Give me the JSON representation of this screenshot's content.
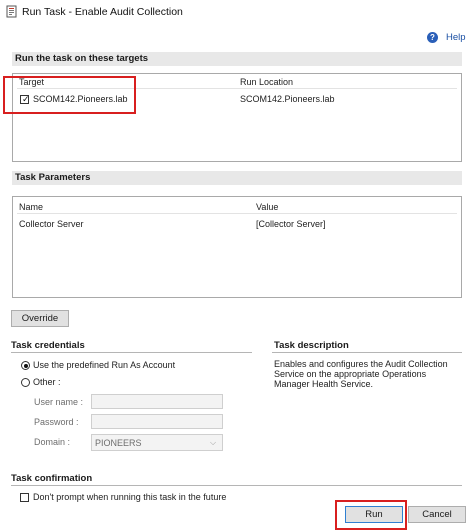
{
  "window": {
    "title": "Run Task - Enable Audit Collection",
    "icon": "task-icon"
  },
  "help": {
    "label": "Help",
    "icon": "help-icon"
  },
  "targets": {
    "header": "Run the task on these targets",
    "columns": [
      "Target",
      "Run Location"
    ],
    "rows": [
      {
        "target": "SCOM142.Pioneers.lab",
        "run_location": "SCOM142.Pioneers.lab",
        "checked": true
      }
    ]
  },
  "parameters": {
    "header": "Task Parameters",
    "columns": [
      "Name",
      "Value"
    ],
    "rows": [
      {
        "name": "Collector Server",
        "value": "[Collector Server]"
      }
    ]
  },
  "override_button": "Override",
  "credentials": {
    "header": "Task credentials",
    "option_default": "Use the predefined Run As Account",
    "option_other": "Other :",
    "selected": "default",
    "username_label": "User name :",
    "password_label": "Password :",
    "domain_label": "Domain :",
    "domain_value": "PIONEERS"
  },
  "description": {
    "header": "Task description",
    "text": "Enables and configures the Audit Collection Service on the appropriate Operations Manager Health Service."
  },
  "confirmation": {
    "header": "Task confirmation",
    "checkbox_label": "Don't prompt when running this task in the future",
    "checked": false
  },
  "buttons": {
    "run": "Run",
    "cancel": "Cancel"
  },
  "colors": {
    "highlight": "#d81f1f",
    "link": "#1a4fa3"
  }
}
